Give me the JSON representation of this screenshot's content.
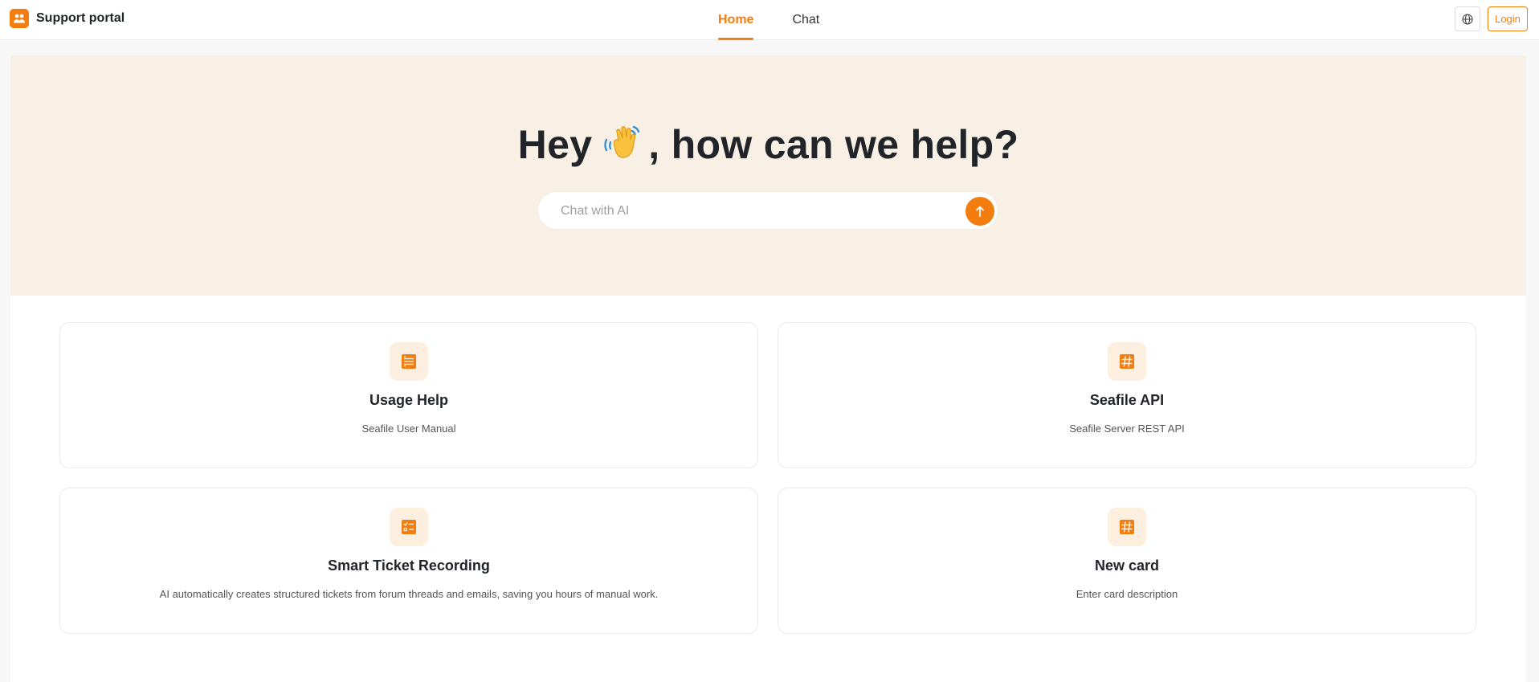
{
  "header": {
    "brand_name": "Support portal",
    "nav": [
      {
        "label": "Home",
        "active": true
      },
      {
        "label": "Chat",
        "active": false
      }
    ],
    "login_label": "Login"
  },
  "hero": {
    "title_before": "Hey",
    "title_after": ", how can we help?",
    "chat_placeholder": "Chat with AI"
  },
  "cards": [
    {
      "icon": "list-icon",
      "title": "Usage Help",
      "description": "Seafile User Manual"
    },
    {
      "icon": "hashtag-icon",
      "title": "Seafile API",
      "description": "Seafile Server REST API"
    },
    {
      "icon": "checklist-icon",
      "title": "Smart Ticket Recording",
      "description": "AI automatically creates structured tickets from forum threads and emails, saving you hours of manual work."
    },
    {
      "icon": "hashtag-icon",
      "title": "New card",
      "description": "Enter card description"
    }
  ],
  "colors": {
    "accent": "#f37d0f",
    "hero_background": "#f8f0e4",
    "icon_background": "#fdefdf"
  }
}
